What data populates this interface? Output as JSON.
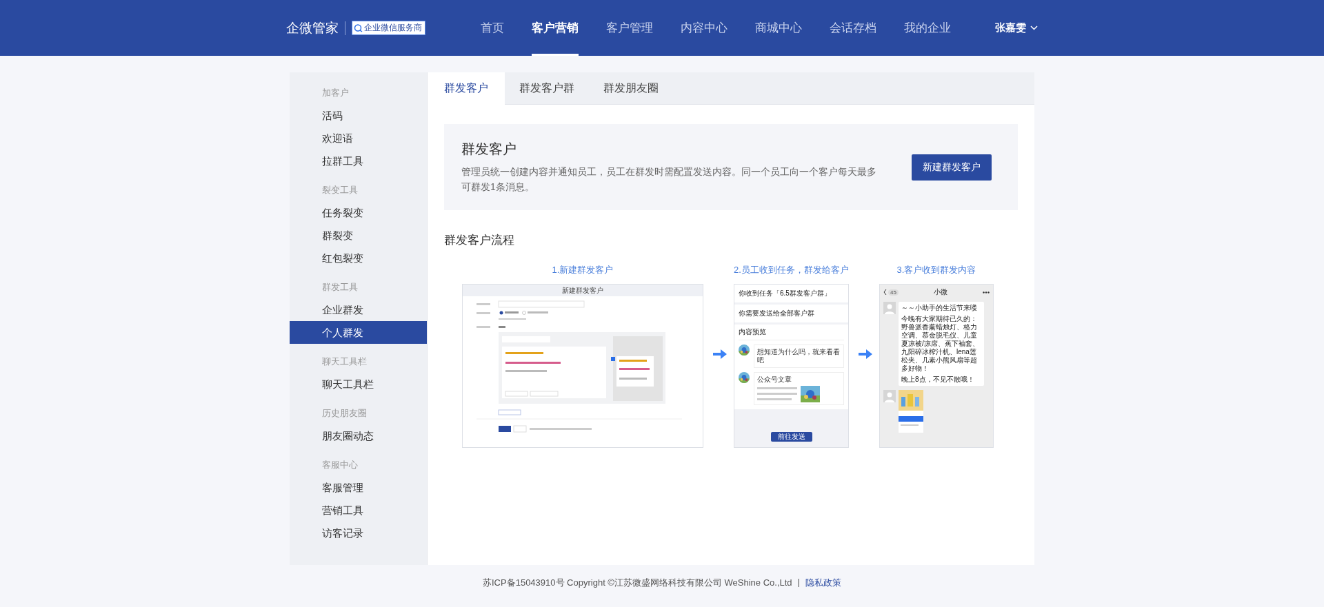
{
  "header": {
    "logo": "企微管家",
    "badge": "企业微信服务商",
    "nav": [
      {
        "label": "首页",
        "selected": false
      },
      {
        "label": "客户营销",
        "selected": true
      },
      {
        "label": "客户管理",
        "selected": false
      },
      {
        "label": "内容中心",
        "selected": false
      },
      {
        "label": "商城中心",
        "selected": false
      },
      {
        "label": "会话存档",
        "selected": false
      },
      {
        "label": "我的企业",
        "selected": false
      }
    ],
    "user": "张嘉雯"
  },
  "sidebar": {
    "groups": [
      {
        "title": "加客户",
        "items": [
          {
            "label": "活码",
            "selected": false
          },
          {
            "label": "欢迎语",
            "selected": false
          },
          {
            "label": "拉群工具",
            "selected": false
          }
        ]
      },
      {
        "title": "裂变工具",
        "items": [
          {
            "label": "任务裂变",
            "selected": false
          },
          {
            "label": "群裂变",
            "selected": false
          },
          {
            "label": "红包裂变",
            "selected": false
          }
        ]
      },
      {
        "title": "群发工具",
        "items": [
          {
            "label": "企业群发",
            "selected": false
          },
          {
            "label": "个人群发",
            "selected": true
          }
        ]
      },
      {
        "title": "聊天工具栏",
        "items": [
          {
            "label": "聊天工具栏",
            "selected": false
          }
        ]
      },
      {
        "title": "历史朋友圈",
        "items": [
          {
            "label": "朋友圈动态",
            "selected": false
          }
        ]
      },
      {
        "title": "客服中心",
        "items": [
          {
            "label": "客服管理",
            "selected": false
          },
          {
            "label": "营销工具",
            "selected": false
          },
          {
            "label": "访客记录",
            "selected": false
          }
        ]
      }
    ]
  },
  "tabs": [
    {
      "label": "群发客户",
      "selected": true
    },
    {
      "label": "群发客户群",
      "selected": false
    },
    {
      "label": "群发朋友圈",
      "selected": false
    }
  ],
  "intro": {
    "title": "群发客户",
    "description": "管理员统一创建内容并通知员工，员工在群发时需配置发送内容。同一个员工向一个客户每天最多可群发1条消息。",
    "button": "新建群发客户"
  },
  "flow": {
    "title": "群发客户流程",
    "steps": [
      {
        "label": "1.新建群发客户",
        "kind": "form",
        "screen": {
          "title": "新建群发客户"
        }
      },
      {
        "label": "2.员工收到任务，群发给客户",
        "kind": "task",
        "screen": {
          "task": "你收到任务「6.5群发客户群」",
          "scope": "你需要发送给全部客户群",
          "preview": "内容预览",
          "message": "想知道为什么吗，就来看看吧",
          "article": "公众号文章",
          "button": "前往发送"
        }
      },
      {
        "label": "3.客户收到群发内容",
        "kind": "chat",
        "screen": {
          "title": "小微",
          "count": "45",
          "greeting": "～～小助手的生活节来喽",
          "body": "今晚有大家期待已久的：野兽派香薰蜡烛灯、格力空调、慕金脱毛仪、儿童夏凉被/凉席、蕉下袖套、九阳碎冰榨汁机、lena莲松夹、几素小熊风扇等超多好物！",
          "closing": "晚上8点，不见不散哦！"
        }
      }
    ]
  },
  "footer": {
    "text": "苏ICP备15043910号 Copyright ©江苏微盛网络科技有限公司 WeShine Co.,Ltd",
    "separator": "|",
    "link": "隐私政策"
  }
}
